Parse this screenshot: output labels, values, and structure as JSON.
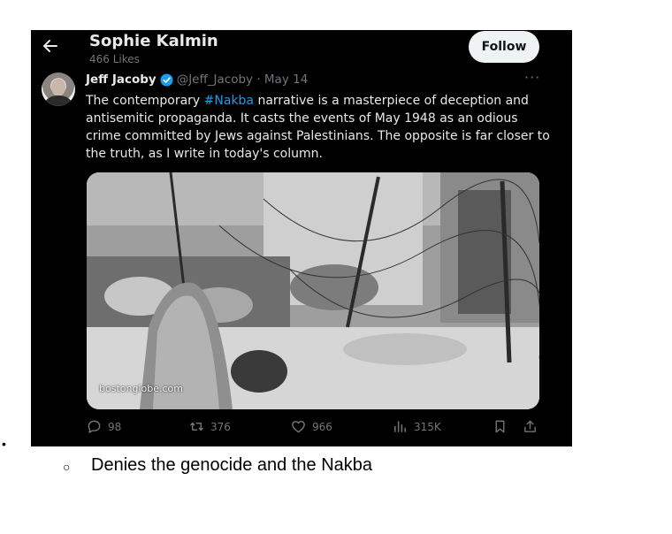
{
  "profile": {
    "name": "Sophie Kalmin",
    "likes": "466 Likes",
    "follow_label": "Follow"
  },
  "tweet": {
    "author": "Jeff Jacoby",
    "handle_date": "@Jeff_Jacoby · May 14",
    "more": "···",
    "text": {
      "line1_before": "The contemporary ",
      "line1_hashtag": "#Nakba",
      "line1_after": " narrative is a masterpiece of deception and",
      "line2": "antisemitic propaganda.  It casts the events of May 1948 as an odious",
      "line3": "crime committed by Jews against Palestinians. The opposite is far closer to",
      "line4": "the  truth, as I write in today's column."
    },
    "photo_watermark": "bostonglobe.com",
    "actions": {
      "replies": "98",
      "reposts": "376",
      "likes": "966",
      "views": "315K"
    }
  },
  "colors": {
    "link": "#1d9bf0",
    "muted": "#71767b",
    "text": "#e7e9ea",
    "background": "#000000"
  },
  "icons": [
    "back-arrow-icon",
    "verified-badge-icon",
    "more-icon",
    "reply-icon",
    "repost-icon",
    "like-icon",
    "views-icon",
    "bookmark-icon",
    "share-icon"
  ],
  "doc": {
    "bullet": "•",
    "sub_bullet": "○",
    "caption": "Denies the genocide and the Nakba"
  }
}
